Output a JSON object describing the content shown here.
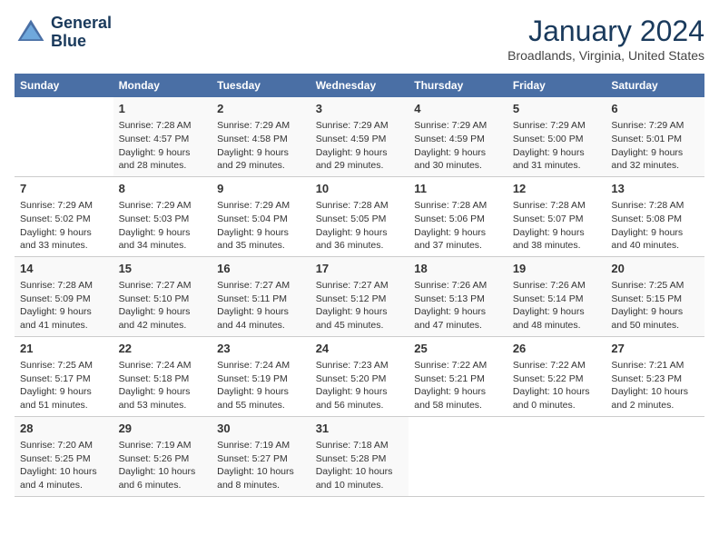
{
  "logo": {
    "line1": "General",
    "line2": "Blue"
  },
  "title": "January 2024",
  "subtitle": "Broadlands, Virginia, United States",
  "days_of_week": [
    "Sunday",
    "Monday",
    "Tuesday",
    "Wednesday",
    "Thursday",
    "Friday",
    "Saturday"
  ],
  "weeks": [
    [
      {
        "num": "",
        "info": ""
      },
      {
        "num": "1",
        "info": "Sunrise: 7:28 AM\nSunset: 4:57 PM\nDaylight: 9 hours\nand 28 minutes."
      },
      {
        "num": "2",
        "info": "Sunrise: 7:29 AM\nSunset: 4:58 PM\nDaylight: 9 hours\nand 29 minutes."
      },
      {
        "num": "3",
        "info": "Sunrise: 7:29 AM\nSunset: 4:59 PM\nDaylight: 9 hours\nand 29 minutes."
      },
      {
        "num": "4",
        "info": "Sunrise: 7:29 AM\nSunset: 4:59 PM\nDaylight: 9 hours\nand 30 minutes."
      },
      {
        "num": "5",
        "info": "Sunrise: 7:29 AM\nSunset: 5:00 PM\nDaylight: 9 hours\nand 31 minutes."
      },
      {
        "num": "6",
        "info": "Sunrise: 7:29 AM\nSunset: 5:01 PM\nDaylight: 9 hours\nand 32 minutes."
      }
    ],
    [
      {
        "num": "7",
        "info": "Sunrise: 7:29 AM\nSunset: 5:02 PM\nDaylight: 9 hours\nand 33 minutes."
      },
      {
        "num": "8",
        "info": "Sunrise: 7:29 AM\nSunset: 5:03 PM\nDaylight: 9 hours\nand 34 minutes."
      },
      {
        "num": "9",
        "info": "Sunrise: 7:29 AM\nSunset: 5:04 PM\nDaylight: 9 hours\nand 35 minutes."
      },
      {
        "num": "10",
        "info": "Sunrise: 7:28 AM\nSunset: 5:05 PM\nDaylight: 9 hours\nand 36 minutes."
      },
      {
        "num": "11",
        "info": "Sunrise: 7:28 AM\nSunset: 5:06 PM\nDaylight: 9 hours\nand 37 minutes."
      },
      {
        "num": "12",
        "info": "Sunrise: 7:28 AM\nSunset: 5:07 PM\nDaylight: 9 hours\nand 38 minutes."
      },
      {
        "num": "13",
        "info": "Sunrise: 7:28 AM\nSunset: 5:08 PM\nDaylight: 9 hours\nand 40 minutes."
      }
    ],
    [
      {
        "num": "14",
        "info": "Sunrise: 7:28 AM\nSunset: 5:09 PM\nDaylight: 9 hours\nand 41 minutes."
      },
      {
        "num": "15",
        "info": "Sunrise: 7:27 AM\nSunset: 5:10 PM\nDaylight: 9 hours\nand 42 minutes."
      },
      {
        "num": "16",
        "info": "Sunrise: 7:27 AM\nSunset: 5:11 PM\nDaylight: 9 hours\nand 44 minutes."
      },
      {
        "num": "17",
        "info": "Sunrise: 7:27 AM\nSunset: 5:12 PM\nDaylight: 9 hours\nand 45 minutes."
      },
      {
        "num": "18",
        "info": "Sunrise: 7:26 AM\nSunset: 5:13 PM\nDaylight: 9 hours\nand 47 minutes."
      },
      {
        "num": "19",
        "info": "Sunrise: 7:26 AM\nSunset: 5:14 PM\nDaylight: 9 hours\nand 48 minutes."
      },
      {
        "num": "20",
        "info": "Sunrise: 7:25 AM\nSunset: 5:15 PM\nDaylight: 9 hours\nand 50 minutes."
      }
    ],
    [
      {
        "num": "21",
        "info": "Sunrise: 7:25 AM\nSunset: 5:17 PM\nDaylight: 9 hours\nand 51 minutes."
      },
      {
        "num": "22",
        "info": "Sunrise: 7:24 AM\nSunset: 5:18 PM\nDaylight: 9 hours\nand 53 minutes."
      },
      {
        "num": "23",
        "info": "Sunrise: 7:24 AM\nSunset: 5:19 PM\nDaylight: 9 hours\nand 55 minutes."
      },
      {
        "num": "24",
        "info": "Sunrise: 7:23 AM\nSunset: 5:20 PM\nDaylight: 9 hours\nand 56 minutes."
      },
      {
        "num": "25",
        "info": "Sunrise: 7:22 AM\nSunset: 5:21 PM\nDaylight: 9 hours\nand 58 minutes."
      },
      {
        "num": "26",
        "info": "Sunrise: 7:22 AM\nSunset: 5:22 PM\nDaylight: 10 hours\nand 0 minutes."
      },
      {
        "num": "27",
        "info": "Sunrise: 7:21 AM\nSunset: 5:23 PM\nDaylight: 10 hours\nand 2 minutes."
      }
    ],
    [
      {
        "num": "28",
        "info": "Sunrise: 7:20 AM\nSunset: 5:25 PM\nDaylight: 10 hours\nand 4 minutes."
      },
      {
        "num": "29",
        "info": "Sunrise: 7:19 AM\nSunset: 5:26 PM\nDaylight: 10 hours\nand 6 minutes."
      },
      {
        "num": "30",
        "info": "Sunrise: 7:19 AM\nSunset: 5:27 PM\nDaylight: 10 hours\nand 8 minutes."
      },
      {
        "num": "31",
        "info": "Sunrise: 7:18 AM\nSunset: 5:28 PM\nDaylight: 10 hours\nand 10 minutes."
      },
      {
        "num": "",
        "info": ""
      },
      {
        "num": "",
        "info": ""
      },
      {
        "num": "",
        "info": ""
      }
    ]
  ]
}
